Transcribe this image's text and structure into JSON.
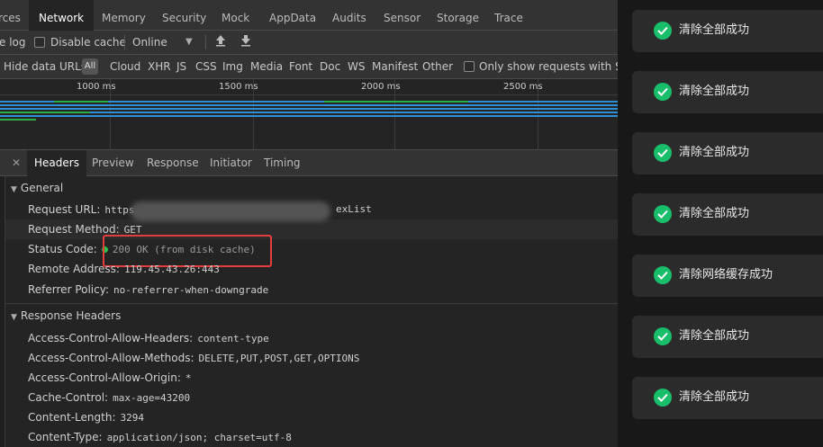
{
  "tabs": [
    "rces",
    "Network",
    "Memory",
    "Security",
    "Mock",
    "AppData",
    "Audits",
    "Sensor",
    "Storage",
    "Trace"
  ],
  "toolbar": {
    "preserve_log": "e log",
    "disable_cache": "Disable cache",
    "throttle": "Online"
  },
  "filter": {
    "hide_data_urls": "Hide data URLs",
    "all": "All",
    "types": [
      "Cloud",
      "XHR",
      "JS",
      "CSS",
      "Img",
      "Media",
      "Font",
      "Doc",
      "WS",
      "Manifest",
      "Other"
    ],
    "same_site": "Only show requests with Sam"
  },
  "timeline": {
    "ticks": [
      "1000 ms",
      "1500 ms",
      "2000 ms",
      "2500 ms"
    ]
  },
  "detail_tabs": [
    "Headers",
    "Preview",
    "Response",
    "Initiator",
    "Timing"
  ],
  "general": {
    "title": "General",
    "rows": [
      {
        "k": "Request URL:",
        "v": "https",
        "v2": "exList"
      },
      {
        "k": "Request Method:",
        "v": "GET"
      },
      {
        "k": "Status Code:",
        "v": "200 OK (from disk cache)"
      },
      {
        "k": "Remote Address:",
        "v": "119.45.43.26:443"
      },
      {
        "k": "Referrer Policy:",
        "v": "no-referrer-when-downgrade"
      }
    ]
  },
  "response_headers": {
    "title": "Response Headers",
    "rows": [
      {
        "k": "Access-Control-Allow-Headers:",
        "v": "content-type"
      },
      {
        "k": "Access-Control-Allow-Methods:",
        "v": "DELETE,PUT,POST,GET,OPTIONS"
      },
      {
        "k": "Access-Control-Allow-Origin:",
        "v": "*"
      },
      {
        "k": "Cache-Control:",
        "v": "max-age=43200"
      },
      {
        "k": "Content-Length:",
        "v": "3294"
      },
      {
        "k": "Content-Type:",
        "v": "application/json; charset=utf-8"
      }
    ]
  },
  "toasts": [
    "清除全部成功",
    "清除全部成功",
    "清除全部成功",
    "清除全部成功",
    "清除网络缓存成功",
    "清除全部成功",
    "清除全部成功"
  ],
  "colors": {
    "success": "#19be6b",
    "highlight": "#e43d3d",
    "status_ok": "#2fc14b"
  }
}
